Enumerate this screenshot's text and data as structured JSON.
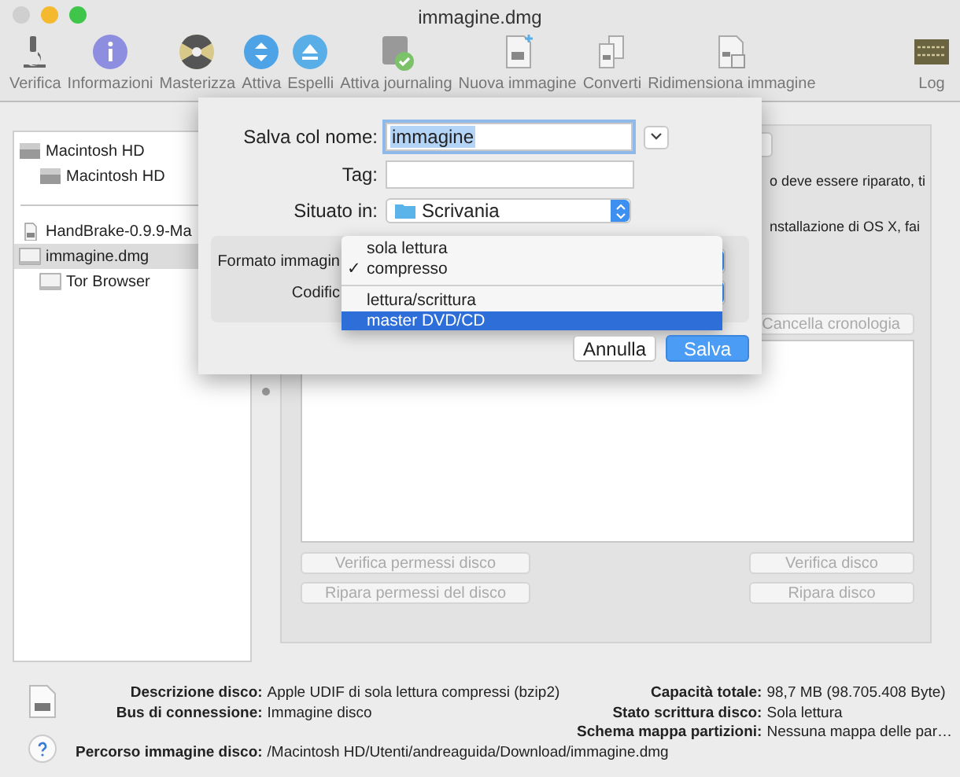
{
  "window": {
    "title": "immagine.dmg"
  },
  "toolbar": [
    {
      "label": "Verifica",
      "kind": "microscope"
    },
    {
      "label": "Informazioni",
      "kind": "info"
    },
    {
      "label": "Masterizza",
      "kind": "burn"
    },
    {
      "label": "Attiva",
      "kind": "mount"
    },
    {
      "label": "Espelli",
      "kind": "eject"
    },
    {
      "label": "Attiva journaling",
      "kind": "journal"
    },
    {
      "label": "Nuova immagine",
      "kind": "newimage"
    },
    {
      "label": "Converti",
      "kind": "convert"
    },
    {
      "label": "Ridimensiona immagine",
      "kind": "resize"
    },
    {
      "label": "Log",
      "kind": "log"
    }
  ],
  "sidebar": {
    "groups": [
      [
        {
          "label": "Macintosh HD",
          "kind": "disk",
          "selected": false,
          "children": [
            {
              "label": "Macintosh HD",
              "kind": "disk",
              "selected": false
            }
          ]
        }
      ],
      [
        {
          "label": "HandBrake-0.9.9-Ma",
          "kind": "file",
          "selected": false
        },
        {
          "label": "immagine.dmg",
          "kind": "image",
          "selected": true,
          "children": [
            {
              "label": "Tor Browser",
              "kind": "image",
              "selected": false
            }
          ]
        }
      ]
    ]
  },
  "panel": {
    "text_lines": [
      "o deve essere riparato, ti",
      "nstallazione di OS X, fai"
    ],
    "clear_button": {
      "label": "Cancella cronologia",
      "disabled": true
    },
    "left_buttons": [
      {
        "label": "Verifica permessi disco",
        "disabled": true
      },
      {
        "label": "Ripara permessi del disco",
        "disabled": true
      }
    ],
    "right_buttons": [
      {
        "label": "Verifica disco",
        "disabled": true
      },
      {
        "label": "Ripara disco",
        "disabled": true
      }
    ]
  },
  "info": {
    "left": [
      {
        "label": "Descrizione disco:",
        "value": "Apple UDIF di sola lettura compressi (bzip2)"
      },
      {
        "label": "Bus di connessione:",
        "value": "Immagine disco"
      }
    ],
    "right": [
      {
        "label": "Capacità totale:",
        "value": "98,7 MB (98.705.408 Byte)"
      },
      {
        "label": "Stato scrittura disco:",
        "value": "Sola lettura"
      },
      {
        "label": "Schema mappa partizioni:",
        "value": "Nessuna mappa delle par…"
      }
    ],
    "path": {
      "label": "Percorso immagine disco:",
      "value": "/Macintosh HD/Utenti/andreaguida/Download/immagine.dmg"
    }
  },
  "sheet": {
    "name_label": "Salva col nome:",
    "name_value": "immagine",
    "tag_label": "Tag:",
    "location_label": "Situato in:",
    "location_value": "Scrivania",
    "format_label": "Formato immagin",
    "encoding_label": "Codific",
    "menu": [
      {
        "label": "sola lettura",
        "selected": false
      },
      {
        "label": "compresso",
        "check": "✓",
        "selected": false
      },
      {
        "label": "lettura/scrittura",
        "selected": false,
        "separator_before": true
      },
      {
        "label": "master DVD/CD",
        "selected": true
      }
    ],
    "cancel": "Annulla",
    "save": "Salva"
  }
}
